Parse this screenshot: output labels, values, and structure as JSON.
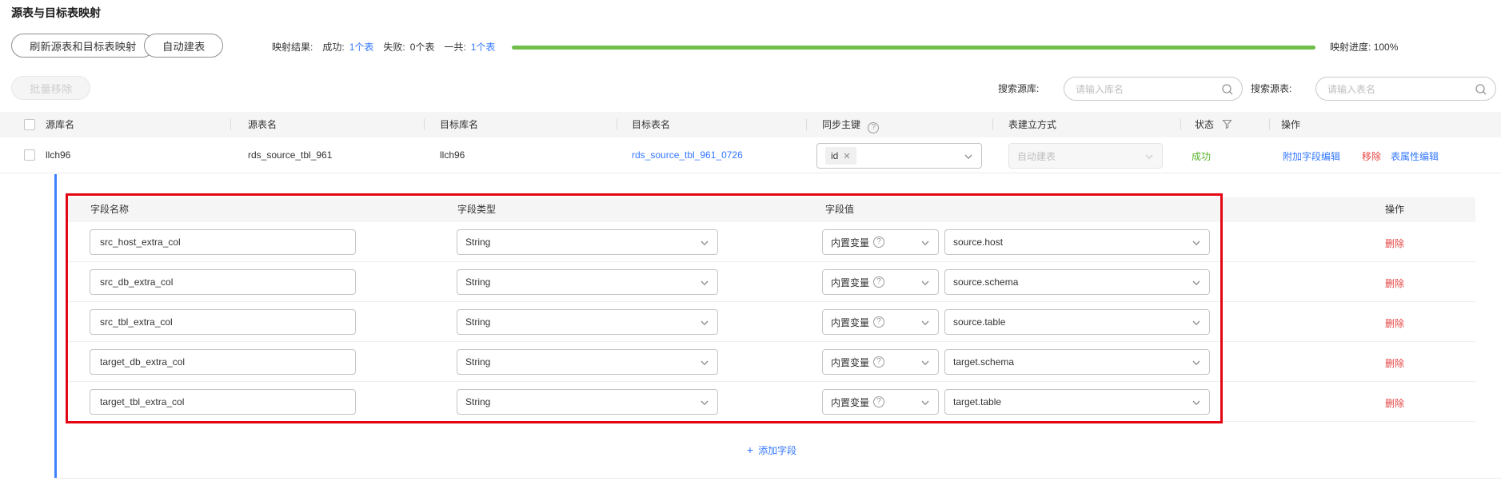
{
  "page": {
    "title": "源表与目标表映射"
  },
  "toolbar": {
    "refresh_button": "刷新源表和目标表映射",
    "auto_create_button": "自动建表",
    "result_label": "映射结果:",
    "success_label": "成功:",
    "success_value": "1个表",
    "fail_label": "失败:",
    "fail_value": "0个表",
    "total_label": "一共:",
    "total_value": "1个表",
    "progress_label": "映射进度:",
    "progress_value": "100%"
  },
  "filters": {
    "batch_remove_button": "批量移除",
    "search_db_label": "搜索源库:",
    "search_db_placeholder": "请输入库名",
    "search_table_label": "搜索源表:",
    "search_table_placeholder": "请输入表名"
  },
  "table": {
    "columns": {
      "c0": "源库名",
      "c1": "源表名",
      "c2": "目标库名",
      "c3": "目标表名",
      "c4": "同步主键",
      "c5": "表建立方式",
      "c6": "状态",
      "c7": "操作"
    },
    "row": {
      "source_db": "llch96",
      "source_table": "rds_source_tbl_961",
      "target_db": "llch96",
      "target_table": "rds_source_tbl_961_0726",
      "sync_key_tag": "id",
      "create_mode": "自动建表",
      "status": "成功",
      "action_extra_fields": "附加字段编辑",
      "action_remove": "移除",
      "action_table_props": "表属性编辑"
    }
  },
  "field_table": {
    "columns": {
      "name": "字段名称",
      "type": "字段类型",
      "value": "字段值",
      "op": "操作"
    },
    "kind_label": "内置变量",
    "delete_label": "删除",
    "add_field_label": "添加字段",
    "rows": [
      {
        "name": "src_host_extra_col",
        "type": "String",
        "kind": "内置变量",
        "value": "source.host"
      },
      {
        "name": "src_db_extra_col",
        "type": "String",
        "kind": "内置变量",
        "value": "source.schema"
      },
      {
        "name": "src_tbl_extra_col",
        "type": "String",
        "kind": "内置变量",
        "value": "source.table"
      },
      {
        "name": "target_db_extra_col",
        "type": "String",
        "kind": "内置变量",
        "value": "target.schema"
      },
      {
        "name": "target_tbl_extra_col",
        "type": "String",
        "kind": "内置变量",
        "value": "target.table"
      }
    ]
  },
  "colors": {
    "accent_blue": "#3377ff",
    "link_red": "#e64545",
    "success_green": "#57b32a",
    "progress_green": "#6fbe4a",
    "annotation_red": "#e30613"
  }
}
